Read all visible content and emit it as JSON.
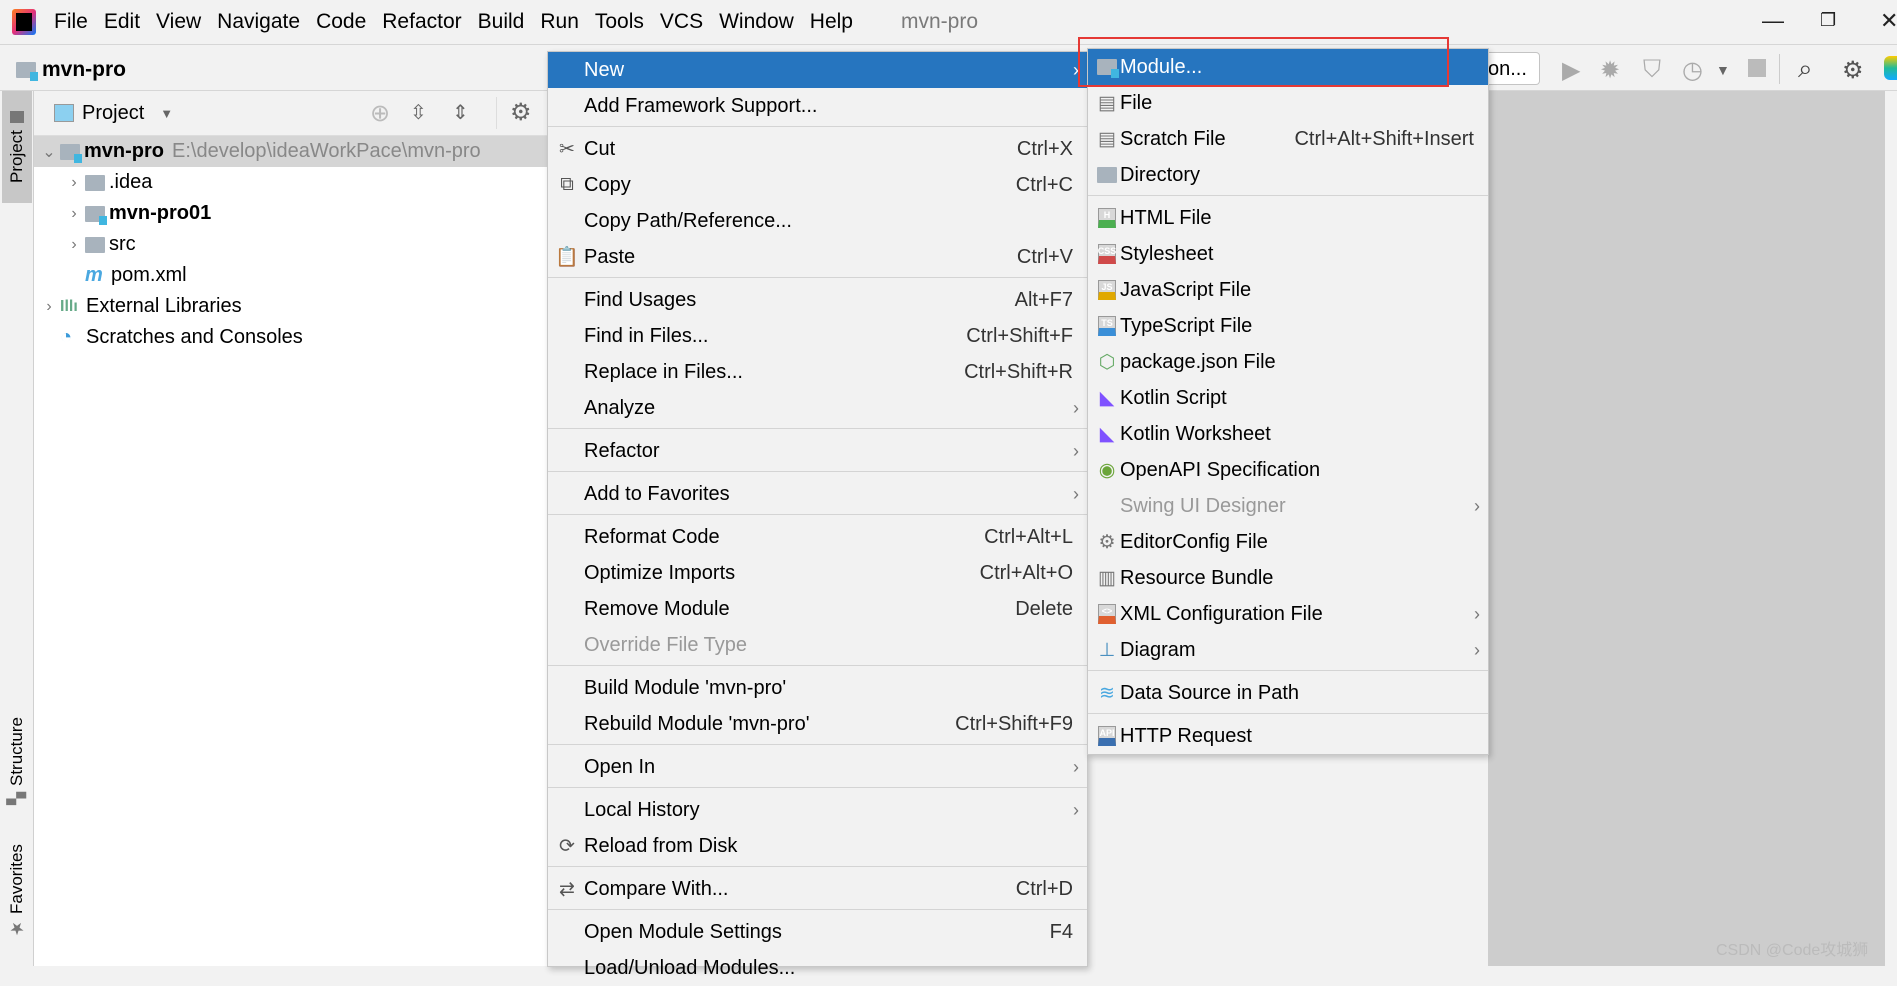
{
  "window": {
    "title": "mvn-pro",
    "controls": [
      "minimize",
      "restore",
      "close"
    ]
  },
  "menubar": [
    "File",
    "Edit",
    "View",
    "Navigate",
    "Code",
    "Refactor",
    "Build",
    "Run",
    "Tools",
    "VCS",
    "Window",
    "Help"
  ],
  "toolbar": {
    "project_name": "mvn-pro",
    "run_config": "on...",
    "icons": [
      "run-icon",
      "debug-icon",
      "coverage-icon",
      "profile-icon",
      "dropdown-icon",
      "stop-icon",
      "search-icon",
      "settings-icon",
      "jetbrains-icon"
    ]
  },
  "side_tabs": {
    "project": "Project",
    "structure": "Structure",
    "favorites": "Favorites"
  },
  "project_panel": {
    "view_label": "Project",
    "tree": [
      {
        "label": "mvn-pro",
        "path": "E:\\develop\\ideaWorkPace\\mvn-pro",
        "indent": 0,
        "expanded": true,
        "icon": "module",
        "selected": true,
        "bold": true
      },
      {
        "label": ".idea",
        "indent": 1,
        "expanded": false,
        "icon": "folder"
      },
      {
        "label": "mvn-pro01",
        "indent": 1,
        "expanded": false,
        "icon": "module",
        "bold": true
      },
      {
        "label": "src",
        "indent": 1,
        "expanded": false,
        "icon": "folder"
      },
      {
        "label": "pom.xml",
        "indent": 1,
        "icon": "maven"
      },
      {
        "label": "External Libraries",
        "indent": 0,
        "expanded": false,
        "icon": "library"
      },
      {
        "label": "Scratches and Consoles",
        "indent": 0,
        "icon": "scratch"
      }
    ]
  },
  "context_menu": [
    {
      "label": "New",
      "submenu": true,
      "highlighted": true
    },
    {
      "label": "Add Framework Support..."
    },
    {
      "sep": true
    },
    {
      "label": "Cut",
      "shortcut": "Ctrl+X",
      "icon": "✂"
    },
    {
      "label": "Copy",
      "shortcut": "Ctrl+C",
      "icon": "⧉"
    },
    {
      "label": "Copy Path/Reference..."
    },
    {
      "label": "Paste",
      "shortcut": "Ctrl+V",
      "icon": "📋"
    },
    {
      "sep": true
    },
    {
      "label": "Find Usages",
      "shortcut": "Alt+F7"
    },
    {
      "label": "Find in Files...",
      "shortcut": "Ctrl+Shift+F"
    },
    {
      "label": "Replace in Files...",
      "shortcut": "Ctrl+Shift+R"
    },
    {
      "label": "Analyze",
      "submenu": true
    },
    {
      "sep": true
    },
    {
      "label": "Refactor",
      "submenu": true
    },
    {
      "sep": true
    },
    {
      "label": "Add to Favorites",
      "submenu": true
    },
    {
      "sep": true
    },
    {
      "label": "Reformat Code",
      "shortcut": "Ctrl+Alt+L"
    },
    {
      "label": "Optimize Imports",
      "shortcut": "Ctrl+Alt+O"
    },
    {
      "label": "Remove Module",
      "shortcut": "Delete"
    },
    {
      "label": "Override File Type",
      "disabled": true
    },
    {
      "sep": true
    },
    {
      "label": "Build Module 'mvn-pro'"
    },
    {
      "label": "Rebuild Module 'mvn-pro'",
      "shortcut": "Ctrl+Shift+F9"
    },
    {
      "sep": true
    },
    {
      "label": "Open In",
      "submenu": true
    },
    {
      "sep": true
    },
    {
      "label": "Local History",
      "submenu": true
    },
    {
      "label": "Reload from Disk",
      "icon": "⟳"
    },
    {
      "sep": true
    },
    {
      "label": "Compare With...",
      "shortcut": "Ctrl+D",
      "icon": "⇄"
    },
    {
      "sep": true
    },
    {
      "label": "Open Module Settings",
      "shortcut": "F4"
    },
    {
      "label": "Load/Unload Modules..."
    }
  ],
  "new_submenu": [
    {
      "label": "Module...",
      "highlighted": true,
      "icon": "module"
    },
    {
      "label": "File",
      "icon": "file"
    },
    {
      "label": "Scratch File",
      "shortcut": "Ctrl+Alt+Shift+Insert",
      "icon": "scratch"
    },
    {
      "label": "Directory",
      "icon": "folder"
    },
    {
      "sep": true
    },
    {
      "label": "HTML File",
      "icon": "H",
      "color": "#4caf50"
    },
    {
      "label": "Stylesheet",
      "icon": "CSS",
      "color": "#d04a4a"
    },
    {
      "label": "JavaScript File",
      "icon": "JS",
      "color": "#e0a800"
    },
    {
      "label": "TypeScript File",
      "icon": "TS",
      "color": "#3a8fd8"
    },
    {
      "label": "package.json File",
      "icon": "npm"
    },
    {
      "label": "Kotlin Script",
      "icon": "kotlin"
    },
    {
      "label": "Kotlin Worksheet",
      "icon": "kotlin"
    },
    {
      "label": "OpenAPI Specification",
      "icon": "openapi"
    },
    {
      "label": "Swing UI Designer",
      "submenu": true,
      "disabled": true
    },
    {
      "label": "EditorConfig File",
      "icon": "gear"
    },
    {
      "label": "Resource Bundle",
      "icon": "bundle"
    },
    {
      "label": "XML Configuration File",
      "submenu": true,
      "icon": "<>",
      "color": "#e06030"
    },
    {
      "label": "Diagram",
      "submenu": true,
      "icon": "diagram"
    },
    {
      "sep": true
    },
    {
      "label": "Data Source in Path",
      "icon": "db"
    },
    {
      "sep": true
    },
    {
      "label": "HTTP Request",
      "icon": "API",
      "color": "#3a6fb0"
    }
  ],
  "watermark": "CSDN @Code攻城狮",
  "colors": {
    "highlight": "#2675bf",
    "annotation_box": "#e53935",
    "editor_bg": "#cdcdcd"
  }
}
